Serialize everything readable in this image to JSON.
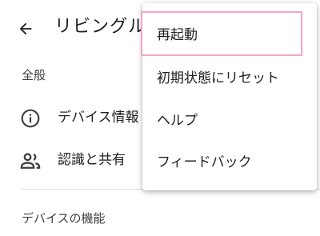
{
  "appbar": {
    "title": "リビングルーム",
    "back_icon": "arrow-left-icon"
  },
  "sections": {
    "general": "全般",
    "device_features": "デバイスの機能"
  },
  "rows": {
    "device_info": {
      "label": "デバイス情報",
      "icon": "info-circle-icon"
    },
    "recognition_sharing": {
      "label": "認識と共有",
      "icon": "people-icon"
    }
  },
  "menu": {
    "items": [
      {
        "label": "再起動"
      },
      {
        "label": "初期状態にリセット"
      },
      {
        "label": "ヘルプ"
      },
      {
        "label": "フィードバック"
      }
    ],
    "highlight_color": "#f4a6c8"
  }
}
